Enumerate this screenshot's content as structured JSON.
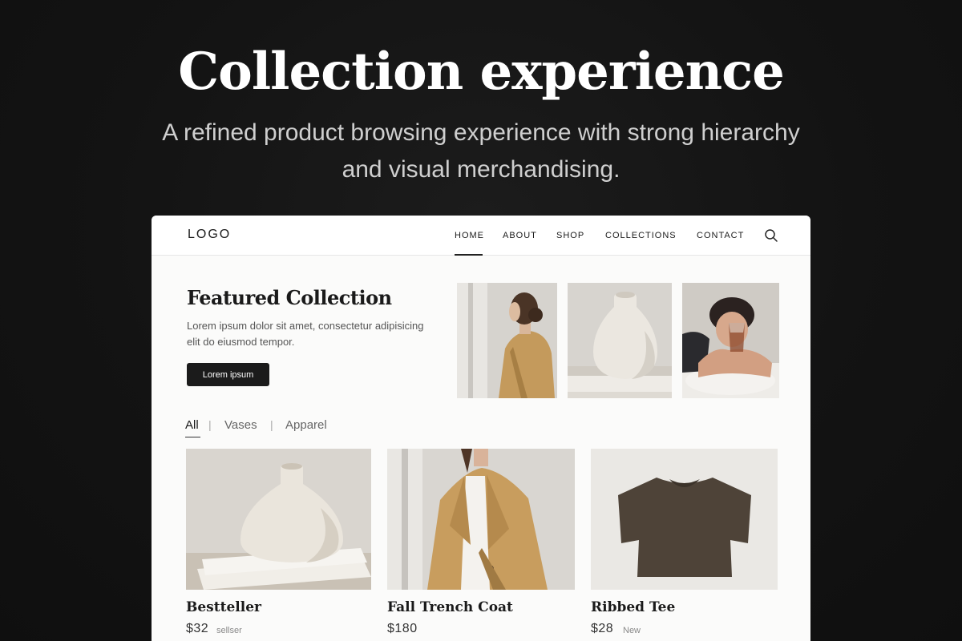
{
  "hero": {
    "title": "Collection experience",
    "subtitle_line1": "A refined product browsing experience with strong hierarchy",
    "subtitle_line2": "and visual merchandising."
  },
  "nav": {
    "logo": "LOGO",
    "items": [
      {
        "label": "HOME",
        "active": true
      },
      {
        "label": "ABOUT",
        "active": false
      },
      {
        "label": "SHOP",
        "active": false
      },
      {
        "label": "COLLECTIONS",
        "active": false
      },
      {
        "label": "CONTACT",
        "active": false
      }
    ],
    "search_icon": "search-icon"
  },
  "featured": {
    "title": "Featured Collection",
    "description": "Lorem ipsum dolor sit amet, consectetur adipisicing elit do eiusmod tempor.",
    "cta_label": "Lorem ipsum",
    "images": [
      "woman-in-trench-coat",
      "ceramic-vase",
      "woman-with-glass"
    ]
  },
  "filters": {
    "items": [
      {
        "label": "All",
        "active": true
      },
      {
        "label": "Vases",
        "active": false
      },
      {
        "label": "Apparel",
        "active": false
      }
    ],
    "separator": "|"
  },
  "products": [
    {
      "name": "Bestteller",
      "price": "$32",
      "tag": "sellser",
      "image": "ceramic-vase"
    },
    {
      "name": "Fall Trench Coat",
      "price": "$180",
      "tag": "",
      "image": "trench-coat"
    },
    {
      "name": "Ribbed Tee",
      "price": "$28",
      "tag": "New",
      "image": "brown-tshirt"
    }
  ],
  "colors": {
    "background": "#121212",
    "card": "#fbfbfa",
    "button": "#1b1b1b",
    "text_primary": "#1a1a1a"
  }
}
